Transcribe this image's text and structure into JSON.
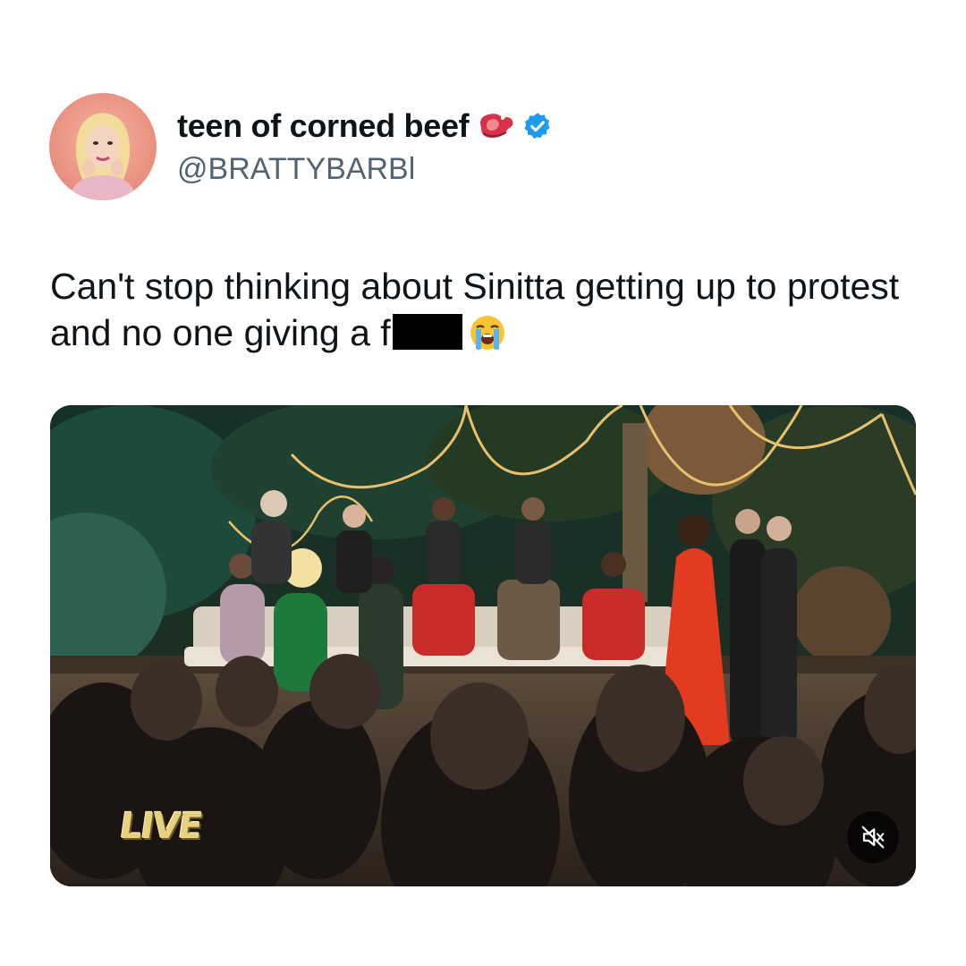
{
  "tweet": {
    "display_name": "teen of corned beef",
    "handle": "@BRATTYBARBl",
    "text": "Can't stop thinking about Sinitta getting up to protest and no one giving a f",
    "name_emoji": "steak-icon",
    "verified": true,
    "text_emoji": "loudly-crying-face-icon"
  },
  "media": {
    "type": "video",
    "overlay_badge": "LIVE",
    "mute_icon": "speaker-muted-icon"
  },
  "colors": {
    "text_primary": "#0f1419",
    "text_secondary": "#536471",
    "verified_blue": "#1d9bf0"
  }
}
